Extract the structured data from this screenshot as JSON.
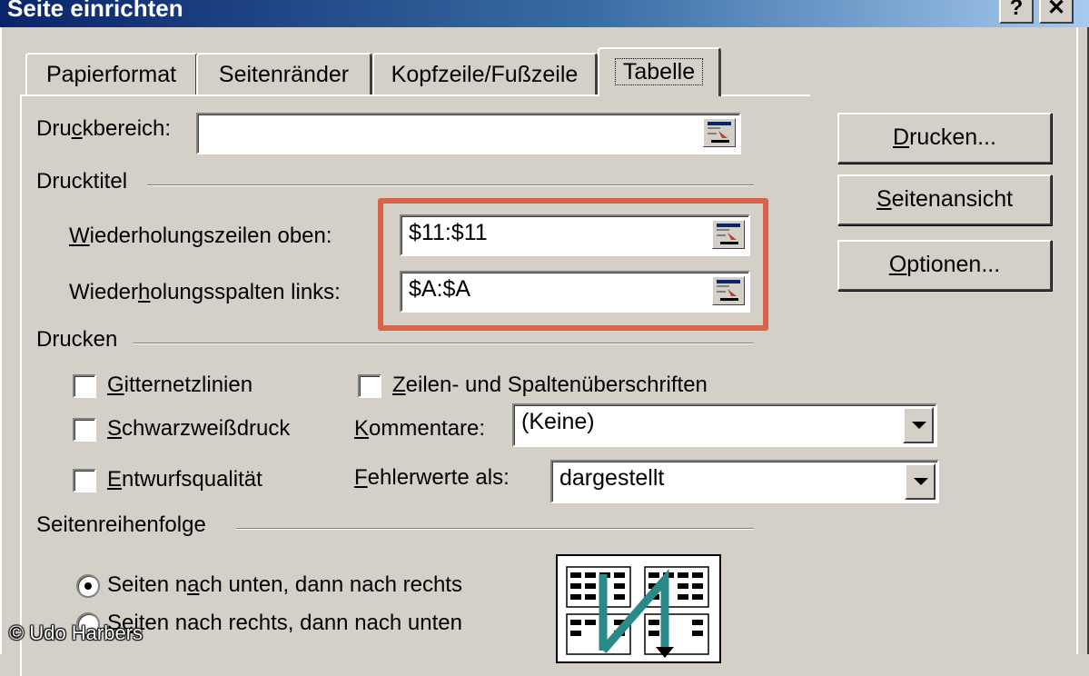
{
  "window": {
    "title": "Seite einrichten",
    "help_label": "?",
    "close_label": "✕"
  },
  "tabs": [
    {
      "label": "Papierformat"
    },
    {
      "label": "Seitenränder"
    },
    {
      "label": "Kopfzeile/Fußzeile"
    },
    {
      "label": "Tabelle",
      "active": true
    }
  ],
  "druckbereich": {
    "label_pre": "Dru",
    "label_u": "c",
    "label_post": "kbereich:",
    "value": ""
  },
  "drucktitel": {
    "group_label": "Drucktitel",
    "rows_label_u": "W",
    "rows_label_post": "iederholungszeilen oben:",
    "rows_value": "$11:$11",
    "cols_label_pre": "Wieder",
    "cols_label_u": "h",
    "cols_label_post": "olungsspalten links:",
    "cols_value": "$A:$A"
  },
  "drucken": {
    "group_label": "Drucken",
    "gitter": {
      "u": "G",
      "post": "itternetzlinien",
      "checked": false
    },
    "schwarz": {
      "u": "S",
      "post": "chwarzweißdruck",
      "checked": false
    },
    "entwurf": {
      "u": "E",
      "post": "ntwurfsqualität",
      "checked": false
    },
    "zeilen": {
      "u": "Z",
      "post": "eilen- und Spaltenüberschriften",
      "checked": false
    },
    "kommentare": {
      "u": "K",
      "post": "ommentare:",
      "value": "(Keine)"
    },
    "fehler": {
      "u": "F",
      "post": "ehlerwerte als:",
      "value": "dargestellt"
    }
  },
  "reihenfolge": {
    "group_label": "Seitenreihenfolge",
    "option1": {
      "pre": "Seiten n",
      "u": "a",
      "post": "ch unten, dann nach rechts",
      "selected": true
    },
    "option2": {
      "pre": "S",
      "u": "e",
      "post": "iten nach rechts, dann nach unten",
      "selected": false
    }
  },
  "buttons": {
    "drucken": {
      "u": "D",
      "post": "rucken..."
    },
    "seitenansicht": {
      "u": "S",
      "post": "eitenansicht"
    },
    "optionen": {
      "u": "O",
      "post": "ptionen..."
    }
  },
  "copyright": "© Udo Harbers",
  "colors": {
    "highlight": "#d9634a",
    "preview_arrow": "#2a8a8a"
  },
  "icons": [
    "collapse-dialog-icon",
    "dropdown-arrow-icon",
    "page-order-preview-icon"
  ]
}
